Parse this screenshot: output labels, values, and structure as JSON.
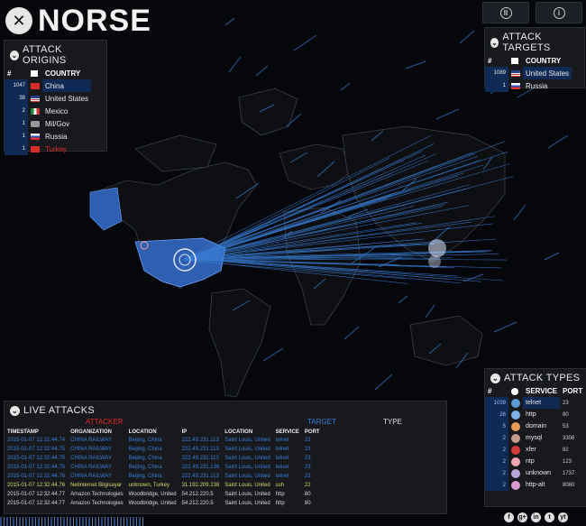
{
  "app": {
    "title": "NORSE",
    "logo_glyph": "✕"
  },
  "top_buttons": [
    {
      "icon": "pause-icon",
      "glyph": "II"
    },
    {
      "icon": "info-icon",
      "glyph": "i"
    }
  ],
  "origins": {
    "title": "ATTACK ORIGINS",
    "col_hash": "#",
    "col_country": "COUNTRY",
    "rows": [
      {
        "count": "1047",
        "country": "China",
        "flag": "cn",
        "highlight": true
      },
      {
        "count": "38",
        "country": "United States",
        "flag": "us"
      },
      {
        "count": "2",
        "country": "Mexico",
        "flag": "mx"
      },
      {
        "count": "1",
        "country": "Mil/Gov",
        "flag": "mil"
      },
      {
        "count": "1",
        "country": "Russia",
        "flag": "ru"
      },
      {
        "count": "1",
        "country": "Turkey",
        "flag": "tr",
        "alert": true
      }
    ]
  },
  "targets": {
    "title": "ATTACK TARGETS",
    "col_hash": "#",
    "col_country": "COUNTRY",
    "rows": [
      {
        "count": "1089",
        "country": "United States",
        "flag": "us",
        "highlight": true
      },
      {
        "count": "1",
        "country": "Russia",
        "flag": "ru"
      }
    ]
  },
  "types": {
    "title": "ATTACK TYPES",
    "col_hash": "#",
    "col_service": "SERVICE",
    "col_port": "PORT",
    "rows": [
      {
        "count": "1039",
        "service": "telnet",
        "port": "23",
        "color": "#5b9bd5",
        "highlight": true
      },
      {
        "count": "26",
        "service": "http",
        "port": "80",
        "color": "#7fb0e8"
      },
      {
        "count": "5",
        "service": "domain",
        "port": "53",
        "color": "#e69a55"
      },
      {
        "count": "2",
        "service": "mysql",
        "port": "3306",
        "color": "#c89a8c"
      },
      {
        "count": "2",
        "service": "xfer",
        "port": "82",
        "color": "#d33a3a"
      },
      {
        "count": "2",
        "service": "ntp",
        "port": "123",
        "color": "#f0a6b0"
      },
      {
        "count": "2",
        "service": "unknown",
        "port": "1737",
        "color": "#b8a6d8"
      },
      {
        "count": "2",
        "service": "http-alt",
        "port": "8080",
        "color": "#d89ad0"
      }
    ]
  },
  "live": {
    "title": "LIVE ATTACKS",
    "attacker_label": "ATTACKER",
    "target_label": "TARGET",
    "type_label": "TYPE",
    "headers": [
      "TIMESTAMP",
      "ORGANIZATION",
      "LOCATION",
      "IP",
      "LOCATION",
      "SERVICE",
      "PORT"
    ],
    "rows": [
      {
        "ts": "2015-01-07 12:32:44.74",
        "org": "CHINA RAILWAY",
        "loc": "Beijing, China",
        "ip": "222.49.231.113",
        "tloc": "Saint Louis, United",
        "svc": "telnet",
        "port": "23",
        "style": "blue"
      },
      {
        "ts": "2015-01-07 12:32:44.75",
        "org": "CHINA RAILWAY",
        "loc": "Beijing, China",
        "ip": "222.49.231.113",
        "tloc": "Saint Louis, United",
        "svc": "telnet",
        "port": "23",
        "style": "blue"
      },
      {
        "ts": "2015-01-07 12:32:44.75",
        "org": "CHINA RAILWAY",
        "loc": "Beijing, China",
        "ip": "222.49.231.113",
        "tloc": "Saint Louis, United",
        "svc": "telnet",
        "port": "23",
        "style": "blue"
      },
      {
        "ts": "2015-01-07 12:32:44.75",
        "org": "CHINA RAILWAY",
        "loc": "Beijing, China",
        "ip": "222.49.231.138",
        "tloc": "Saint Louis, United",
        "svc": "telnet",
        "port": "23",
        "style": "blue"
      },
      {
        "ts": "2015-01-07 12:32:44.76",
        "org": "CHINA RAILWAY",
        "loc": "Beijing, China",
        "ip": "222.49.231.113",
        "tloc": "Saint Louis, United",
        "svc": "telnet",
        "port": "23",
        "style": "blue"
      },
      {
        "ts": "2015-01-07 12:32:44.76",
        "org": "Netinternet Bilgisayar",
        "loc": "unknown, Turkey",
        "ip": "31.192.209.238",
        "tloc": "Saint Louis, United",
        "svc": "ssh",
        "port": "22",
        "style": "yel"
      },
      {
        "ts": "2015-01-07 12:32:44.77",
        "org": "Amazon Technologies",
        "loc": "Woodbridge, United",
        "ip": "54.212.220.5",
        "tloc": "Saint Louis, United",
        "svc": "http",
        "port": "80",
        "style": "wht"
      },
      {
        "ts": "2015-01-07 12:32:44.77",
        "org": "Amazon Technologies",
        "loc": "Woodbridge, United",
        "ip": "54.212.220.5",
        "tloc": "Saint Louis, United",
        "svc": "http",
        "port": "80",
        "style": "wht"
      }
    ]
  },
  "social": [
    "f",
    "g+",
    "in",
    "t",
    "yt"
  ],
  "colors": {
    "attack_blue": "#3a7fd6",
    "us_blue": "#2f5fb0",
    "alert_red": "#e02b2b"
  }
}
